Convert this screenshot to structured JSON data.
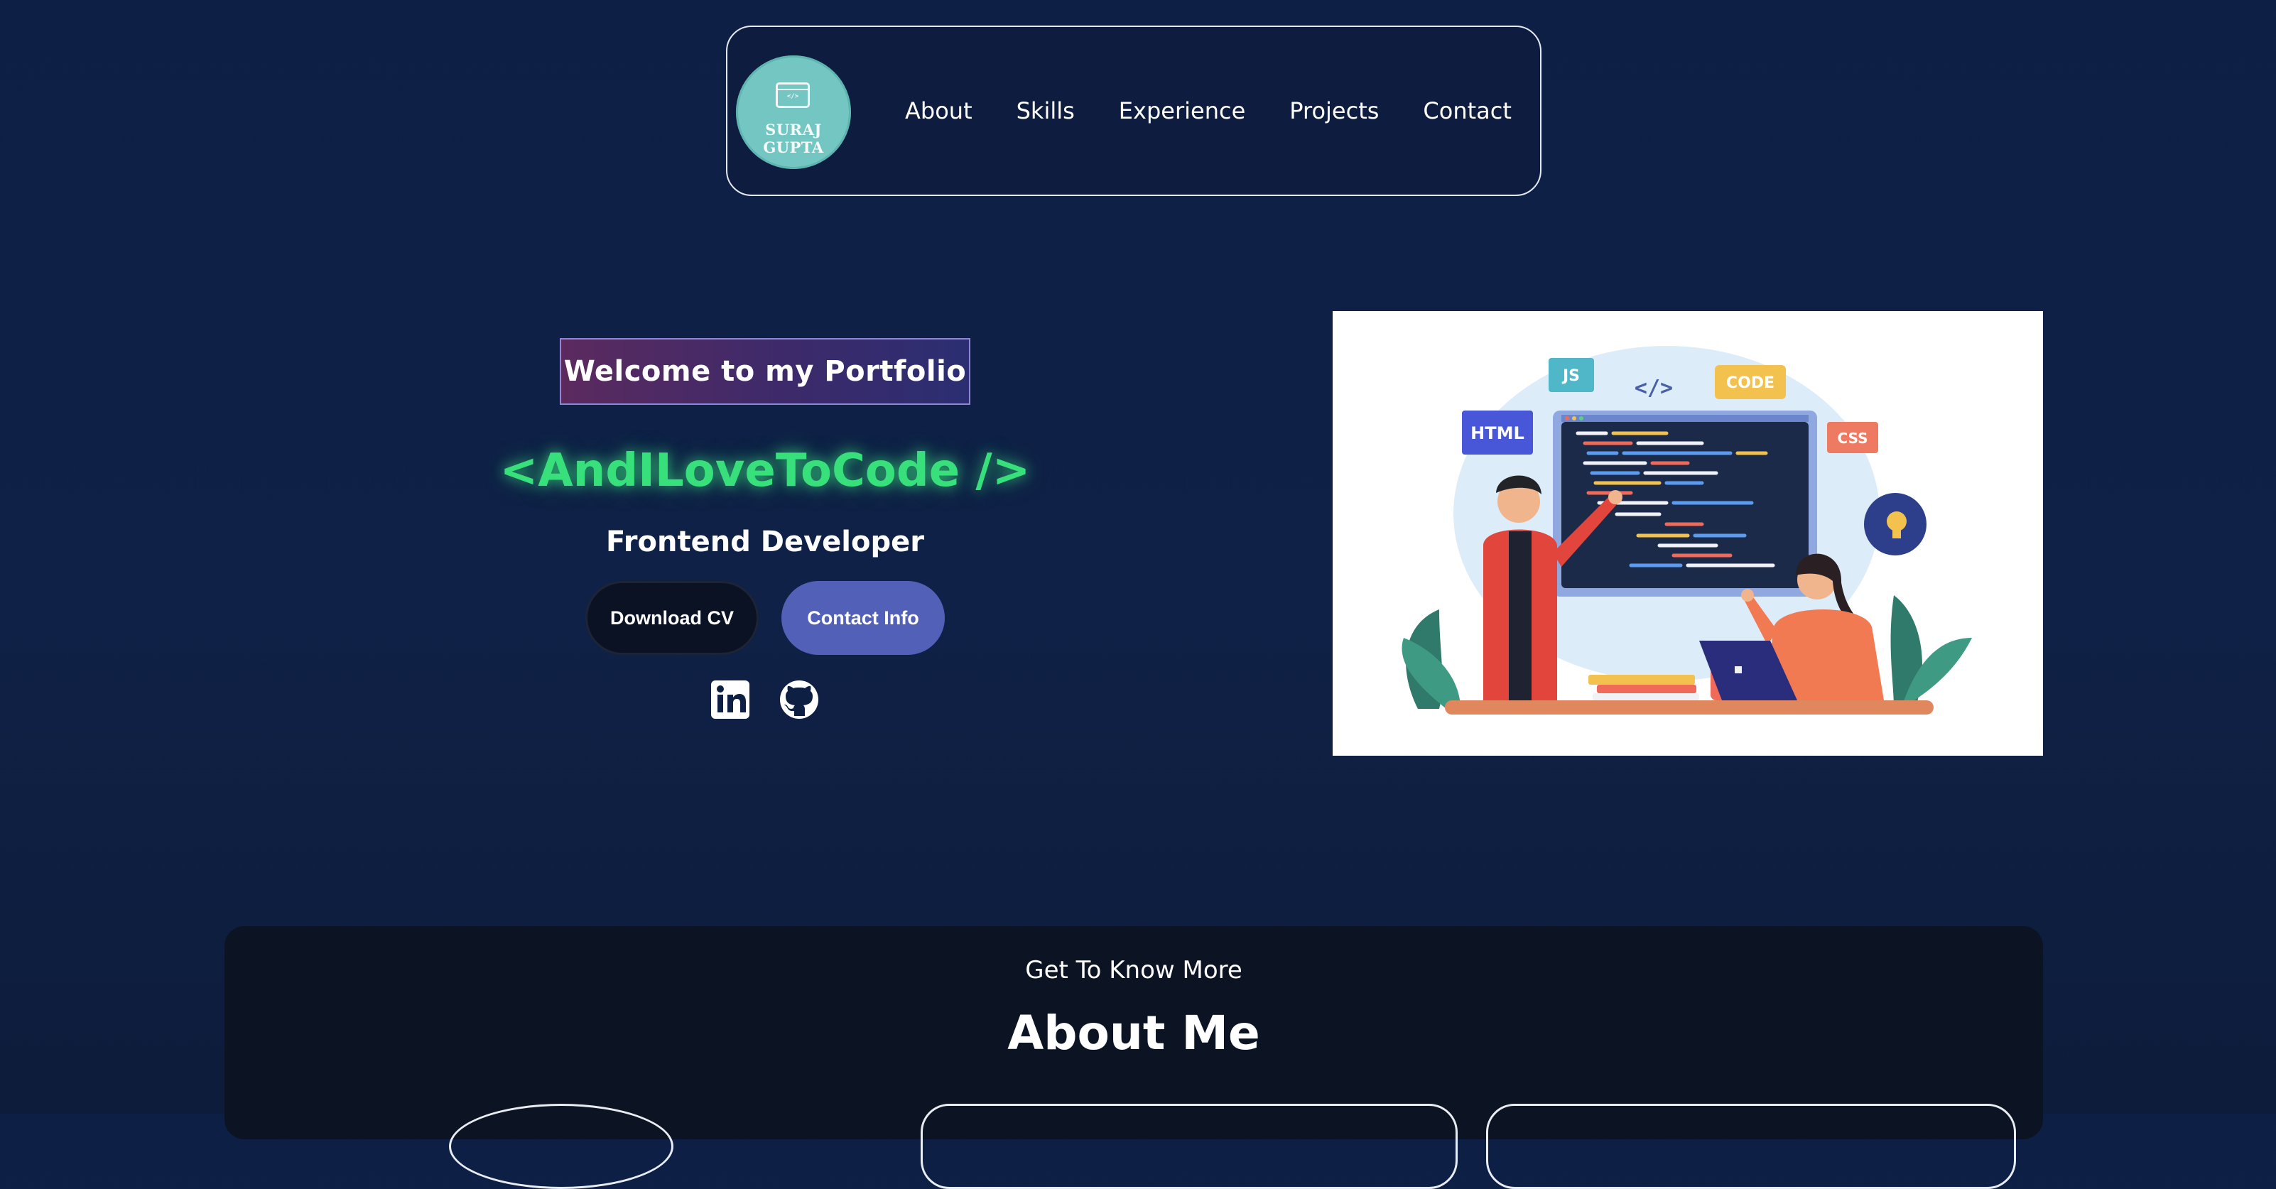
{
  "nav": {
    "logo": {
      "icon_text": "</>",
      "name": "SURAJ GUPTA"
    },
    "links": [
      "About",
      "Skills",
      "Experience",
      "Projects",
      "Contact"
    ]
  },
  "hero": {
    "welcome": "Welcome to my Portfolio",
    "tagline": "<AndILoveToCode />",
    "role": "Frontend Developer",
    "buttons": {
      "cv": "Download CV",
      "contact": "Contact Info"
    },
    "social": {
      "linkedin_icon": "linkedin-icon",
      "github_icon": "github-icon"
    },
    "illustration": {
      "tags": [
        "JS",
        "</>",
        "CODE",
        "HTML",
        "CSS"
      ]
    }
  },
  "about": {
    "subtitle": "Get To Know More",
    "title": "About Me"
  },
  "colors": {
    "background": "#0d1f45",
    "accent_green": "#38e07c",
    "contact_button": "#5360b8",
    "logo_teal": "#74c6c2"
  }
}
